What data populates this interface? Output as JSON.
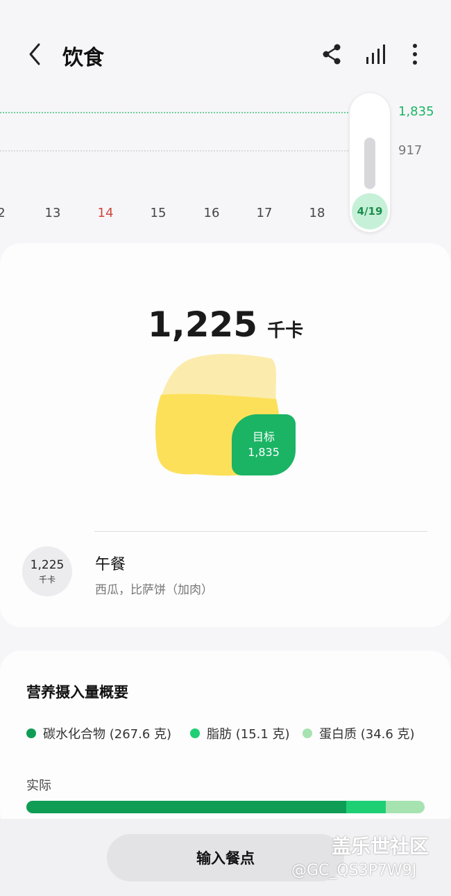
{
  "header": {
    "title": "饮食",
    "icons": {
      "back": "back-arrow-icon",
      "share": "share-icon",
      "chart": "bar-chart-icon",
      "more": "more-vertical-icon"
    }
  },
  "trend_chart": {
    "goal_value": "1,835",
    "avg_value": "917",
    "dates": [
      "2",
      "13",
      "14",
      "15",
      "16",
      "17",
      "18"
    ],
    "selected_date": "4/19",
    "colors": {
      "goal": "#1ab464",
      "weekend": "#d0443a",
      "selected_bg": "#c7f0d8"
    }
  },
  "summary": {
    "kcal_value": "1,225",
    "kcal_unit": "千卡",
    "goal_label": "目标",
    "goal_value": "1,835",
    "meal": {
      "kcal": "1,225",
      "unit": "千卡",
      "name": "午餐",
      "items": "西瓜，比萨饼（加肉）"
    }
  },
  "nutrition": {
    "title": "营养摄入量概要",
    "legend": [
      {
        "label": "碳水化合物 (267.6 克)",
        "color": "#0f9d55"
      },
      {
        "label": "脂肪 (15.1 克)",
        "color": "#1ecf74"
      },
      {
        "label": "蛋白质 (34.6 克)",
        "color": "#a6e3b1"
      }
    ],
    "actual_label": "实际",
    "bar_fractions": [
      0.803,
      0.1,
      0.097
    ]
  },
  "footer": {
    "input_button": "输入餐点",
    "watermark_title": "盖乐世社区",
    "watermark_user": "@GC_QS3P7W9J"
  }
}
